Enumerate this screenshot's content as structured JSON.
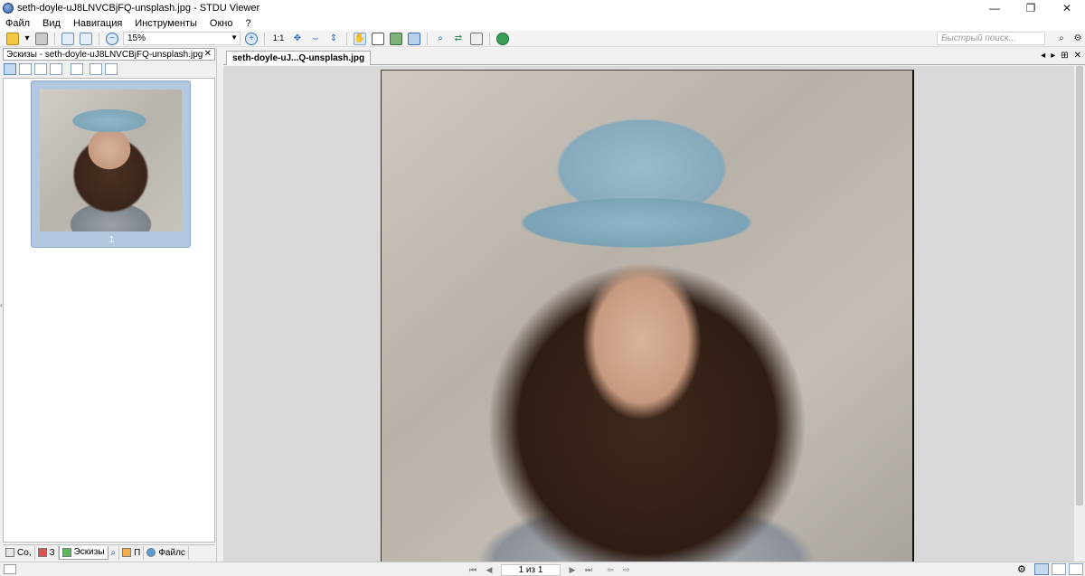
{
  "window": {
    "title": "seth-doyle-uJ8LNVCBjFQ-unsplash.jpg - STDU Viewer",
    "minimize_glyph": "—",
    "restore_glyph": "❐",
    "close_glyph": "✕"
  },
  "menu": [
    "Файл",
    "Вид",
    "Навигация",
    "Инструменты",
    "Окно",
    "?"
  ],
  "toolbar": {
    "zoom_value": "15%",
    "actual_size_label": "1:1",
    "search_placeholder": "Быстрый поиск..."
  },
  "left_panel": {
    "header": "Эскизы - seth-doyle-uJ8LNVCBjFQ-unsplash.jpg",
    "close_glyph": "✕",
    "thumbnail_page_label": "1",
    "tabs": [
      "Со,",
      "З",
      "Эскизы",
      "",
      "П",
      "Файлс"
    ],
    "active_tab": "Эскизы"
  },
  "document": {
    "tab_label": "seth-doyle-uJ...Q-unsplash.jpg",
    "tab_controls": [
      "◂",
      "▸",
      "⊞",
      "✕"
    ]
  },
  "status": {
    "page_indicator": "1 из 1"
  },
  "colors": {
    "selection": "#b3c8e0",
    "workspace": "#d9d9d9"
  }
}
